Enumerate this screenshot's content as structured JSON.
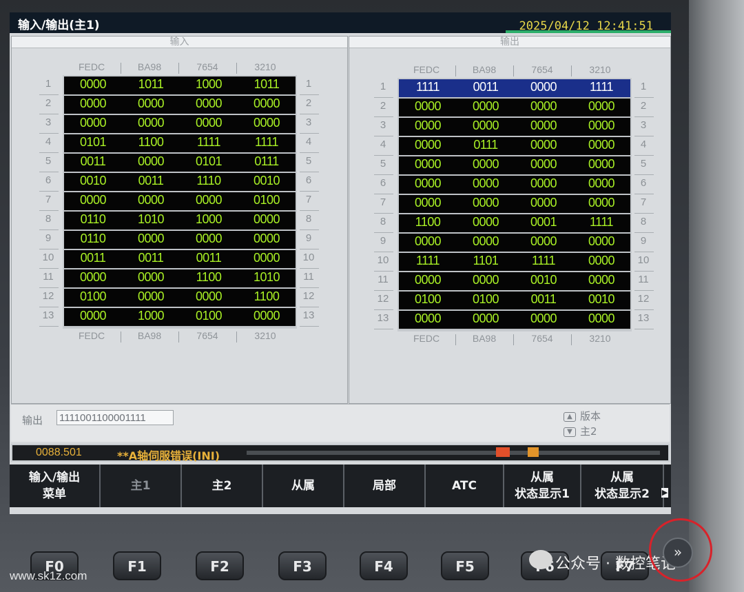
{
  "window": {
    "title": "输入/输出(主1)",
    "datetime": "2025/04/12 12:41:51"
  },
  "input_panel": {
    "header": "输入",
    "columns": [
      "FEDC",
      "BA98",
      "7654",
      "3210"
    ],
    "rows": [
      {
        "num": "1",
        "cells": [
          "0000",
          "1011",
          "1000",
          "1011"
        ]
      },
      {
        "num": "2",
        "cells": [
          "0000",
          "0000",
          "0000",
          "0000"
        ]
      },
      {
        "num": "3",
        "cells": [
          "0000",
          "0000",
          "0000",
          "0000"
        ]
      },
      {
        "num": "4",
        "cells": [
          "0101",
          "1100",
          "1111",
          "1111"
        ]
      },
      {
        "num": "5",
        "cells": [
          "0011",
          "0000",
          "0101",
          "0111"
        ]
      },
      {
        "num": "6",
        "cells": [
          "0010",
          "0011",
          "1110",
          "0010"
        ]
      },
      {
        "num": "7",
        "cells": [
          "0000",
          "0000",
          "0000",
          "0100"
        ]
      },
      {
        "num": "8",
        "cells": [
          "0110",
          "1010",
          "1000",
          "0000"
        ]
      },
      {
        "num": "9",
        "cells": [
          "0110",
          "0000",
          "0000",
          "0000"
        ]
      },
      {
        "num": "10",
        "cells": [
          "0011",
          "0011",
          "0011",
          "0000"
        ]
      },
      {
        "num": "11",
        "cells": [
          "0000",
          "0000",
          "1100",
          "1010"
        ]
      },
      {
        "num": "12",
        "cells": [
          "0100",
          "0000",
          "0000",
          "1100"
        ]
      },
      {
        "num": "13",
        "cells": [
          "0000",
          "1000",
          "0100",
          "0000"
        ]
      }
    ]
  },
  "output_panel": {
    "header": "输出",
    "columns": [
      "FEDC",
      "BA98",
      "7654",
      "3210"
    ],
    "rows": [
      {
        "num": "1",
        "cells": [
          "1111",
          "0011",
          "0000",
          "1111"
        ],
        "selected": true
      },
      {
        "num": "2",
        "cells": [
          "0000",
          "0000",
          "0000",
          "0000"
        ]
      },
      {
        "num": "3",
        "cells": [
          "0000",
          "0000",
          "0000",
          "0000"
        ]
      },
      {
        "num": "4",
        "cells": [
          "0000",
          "0111",
          "0000",
          "0000"
        ]
      },
      {
        "num": "5",
        "cells": [
          "0000",
          "0000",
          "0000",
          "0000"
        ]
      },
      {
        "num": "6",
        "cells": [
          "0000",
          "0000",
          "0000",
          "0000"
        ]
      },
      {
        "num": "7",
        "cells": [
          "0000",
          "0000",
          "0000",
          "0000"
        ]
      },
      {
        "num": "8",
        "cells": [
          "1100",
          "0000",
          "0001",
          "1111"
        ]
      },
      {
        "num": "9",
        "cells": [
          "0000",
          "0000",
          "0000",
          "0000"
        ]
      },
      {
        "num": "10",
        "cells": [
          "1111",
          "1101",
          "1111",
          "0000"
        ]
      },
      {
        "num": "11",
        "cells": [
          "0000",
          "0000",
          "0010",
          "0000"
        ]
      },
      {
        "num": "12",
        "cells": [
          "0100",
          "0100",
          "0011",
          "0010"
        ]
      },
      {
        "num": "13",
        "cells": [
          "0000",
          "0000",
          "0000",
          "0000"
        ]
      }
    ]
  },
  "output_field": {
    "label": "输出",
    "value": "1111001100001111"
  },
  "page_controls": {
    "up_label": "版本",
    "down_label": "主2"
  },
  "alarm": {
    "code": "0088.501",
    "message": "**A轴伺服错误(INI)"
  },
  "softkeys": [
    {
      "label": "输入/输出\n菜单",
      "enabled": true
    },
    {
      "label": "主1",
      "enabled": false
    },
    {
      "label": "主2",
      "enabled": true
    },
    {
      "label": "从属",
      "enabled": true
    },
    {
      "label": "局部",
      "enabled": true
    },
    {
      "label": "ATC",
      "enabled": true
    },
    {
      "label": "从属\n状态显示1",
      "enabled": true
    },
    {
      "label": "从属\n状态显示2",
      "enabled": true
    }
  ],
  "hardware_keys": [
    "F0",
    "F1",
    "F2",
    "F3",
    "F4",
    "F5",
    "F6",
    "F7"
  ],
  "watermark": {
    "site": "www.sk1z.com",
    "wechat": "公众号 · 数控笔记"
  },
  "colors": {
    "cell_text": "#aaf225",
    "selected_row": "#1a2f8a",
    "alarm_text": "#e8b13a",
    "highlight_circle": "#d8222a"
  }
}
